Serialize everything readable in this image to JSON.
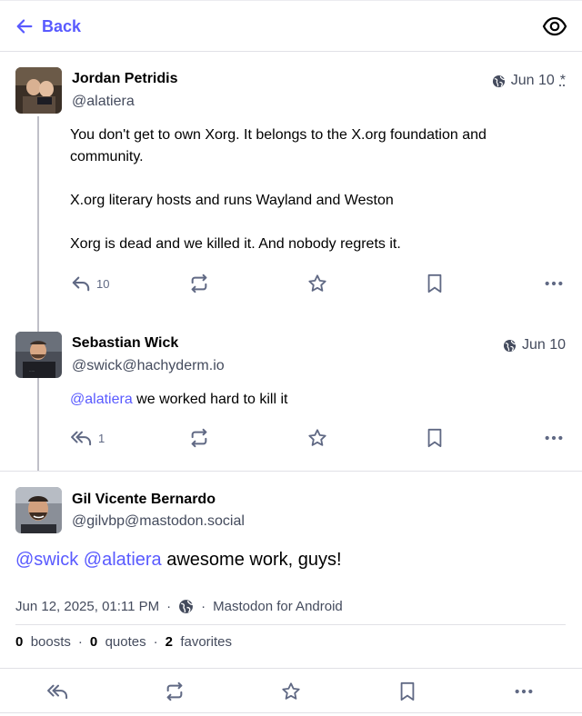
{
  "header": {
    "back_label": "Back",
    "back_icon": "arrow-left-icon",
    "watch_icon": "eye-icon"
  },
  "colors": {
    "accent": "#595aff",
    "secondary_text": "#444b5d",
    "action_icon": "#606984",
    "divider": "#e1e1e6"
  },
  "statuses": [
    {
      "name": "Jordan Petridis",
      "handle": "@alatiera",
      "visibility_icon": "globe-icon",
      "date": "Jun 10",
      "edited_mark": "*",
      "paragraphs": [
        "You don't get to own Xorg. It belongs to the X.org foundation and community.",
        "X.org literary hosts and runs Wayland and Weston",
        "Xorg is dead and we killed it. And nobody regrets it."
      ],
      "reply_count": "10"
    },
    {
      "name": "Sebastian Wick",
      "handle": "@swick@hachyderm.io",
      "visibility_icon": "globe-icon",
      "date": "Jun 10",
      "mention": "@alatiera",
      "text": " we worked hard to kill it",
      "reply_count": "1"
    }
  ],
  "focused": {
    "name": "Gil Vicente Bernardo",
    "handle": "@gilvbp@mastodon.social",
    "mention1": "@swick",
    "mention2": "@alatiera",
    "text": " awesome work, guys!",
    "timestamp": "Jun 12, 2025, 01:11 PM",
    "separator": "·",
    "visibility_icon": "globe-icon",
    "application": "Mastodon for Android",
    "boosts_count": "0",
    "boosts_label": "boosts",
    "quotes_count": "0",
    "quotes_label": "quotes",
    "favorites_count": "2",
    "favorites_label": "favorites"
  }
}
